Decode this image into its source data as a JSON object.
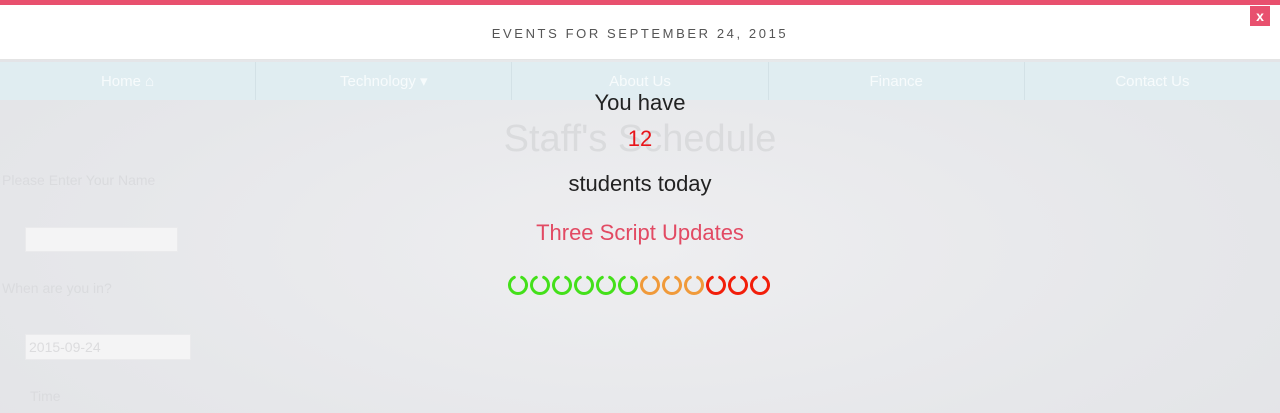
{
  "banner": {
    "title": "EVENTS FOR SEPTEMBER 24, 2015",
    "close_label": "x",
    "accent_color": "#e8506e"
  },
  "background_page": {
    "nav": [
      "Home ⌂",
      "Technology ▾",
      "About Us",
      "Finance",
      "Contact Us"
    ],
    "title": "Staff's Schedule",
    "fields": [
      {
        "label": "Please Enter Your Name",
        "value": ""
      },
      {
        "label": "When are you in?",
        "value": "2015-09-24"
      }
    ],
    "time_label": "Time"
  },
  "popup": {
    "line1": "You have",
    "count": "12",
    "line3": "students today",
    "link": "Three Script Updates",
    "count_color": "#e8141a",
    "link_color": "#e24a63"
  },
  "rings": {
    "colors": [
      "#44e01a",
      "#44e01a",
      "#44e01a",
      "#44e01a",
      "#44e01a",
      "#44e01a",
      "#f09a3a",
      "#f09a3a",
      "#f09a3a",
      "#f21e0a",
      "#f21e0a",
      "#f21e0a"
    ],
    "icon": "loading-ring-icon"
  }
}
